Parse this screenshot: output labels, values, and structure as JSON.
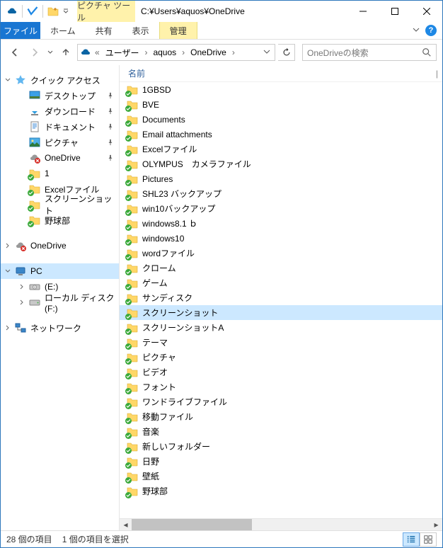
{
  "title": "C:¥Users¥aquos¥OneDrive",
  "contextual_tab": "ピクチャ ツール",
  "tabs": {
    "file": "ファイル",
    "home": "ホーム",
    "share": "共有",
    "view": "表示",
    "manage": "管理"
  },
  "breadcrumb": {
    "sep_first": "«",
    "users": "ユーザー",
    "aquos": "aquos",
    "onedrive": "OneDrive"
  },
  "search_placeholder": "OneDriveの検索",
  "column_name": "名前",
  "sidebar": {
    "quick_access": "クイック アクセス",
    "qa_children": [
      {
        "name": "desktop",
        "label": "デスクトップ",
        "pin": true
      },
      {
        "name": "downloads",
        "label": "ダウンロード",
        "pin": true
      },
      {
        "name": "documents",
        "label": "ドキュメント",
        "pin": true
      },
      {
        "name": "pictures",
        "label": "ピクチャ",
        "pin": true
      },
      {
        "name": "onedrive-qa",
        "label": "OneDrive",
        "pin": true
      },
      {
        "name": "folder-1",
        "label": "1",
        "pin": false
      },
      {
        "name": "excel-files",
        "label": "Excelファイル",
        "pin": false
      },
      {
        "name": "screenshots-qa",
        "label": "スクリーンショット",
        "pin": false
      },
      {
        "name": "baseball-qa",
        "label": "野球部",
        "pin": false
      }
    ],
    "onedrive": "OneDrive",
    "pc": "PC",
    "pc_children": [
      {
        "name": "drive-e",
        "label": "(E:)"
      },
      {
        "name": "drive-f",
        "label": "ローカル ディスク (F:)"
      }
    ],
    "network": "ネットワーク"
  },
  "files": [
    "1GBSD",
    "BVE",
    "Documents",
    "Email attachments",
    "Excelファイル",
    "OLYMPUS　カメラファイル",
    "Pictures",
    "SHL23 バックアップ",
    "win10バックアップ",
    "windows8.1 ｂ",
    "windows10",
    "wordファイル",
    "クローム",
    "ゲーム",
    "サンディスク",
    "スクリーンショット",
    "スクリーンショットA",
    "テーマ",
    "ピクチャ",
    "ビデオ",
    "フォント",
    "ワンドライブファイル",
    "移動ファイル",
    "音楽",
    "新しいフォルダー",
    "日野",
    "壁紙",
    "野球部"
  ],
  "selected_index": 15,
  "status": {
    "count": "28 個の項目",
    "selection": "1 個の項目を選択"
  }
}
